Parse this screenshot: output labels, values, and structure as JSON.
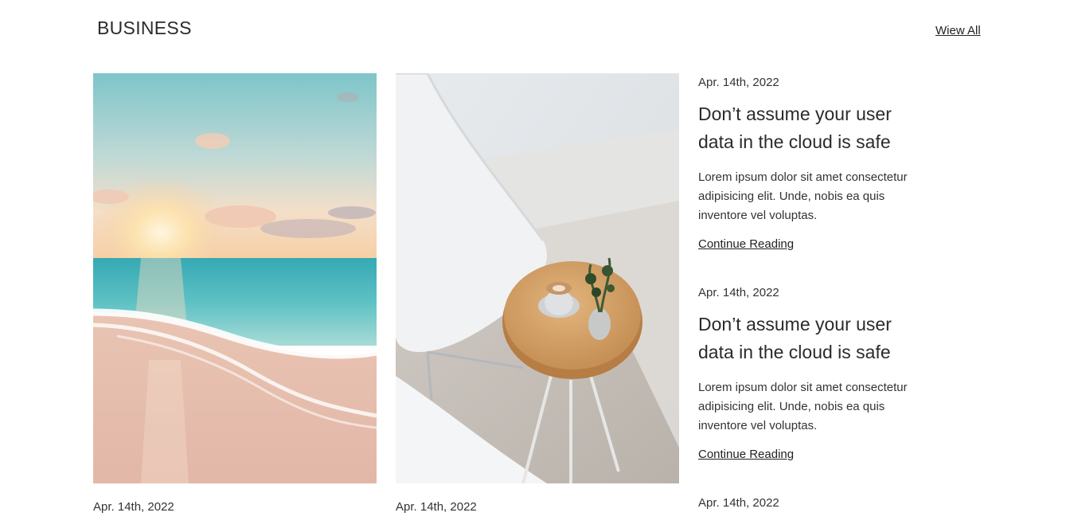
{
  "section": {
    "title": "BUSINESS",
    "view_all": "Wiew All"
  },
  "image_cards": [
    {
      "date": "Apr. 14th, 2022",
      "image": "beach-sunset-image"
    },
    {
      "date": "Apr. 14th, 2022",
      "image": "coffee-table-image"
    }
  ],
  "articles": [
    {
      "date": "Apr. 14th, 2022",
      "title": "Don’t assume your user data in the cloud is safe",
      "excerpt": "Lorem ipsum dolor sit amet consectetur adipisicing elit. Unde, nobis ea quis inventore vel voluptas.",
      "link": "Continue Reading"
    },
    {
      "date": "Apr. 14th, 2022",
      "title": "Don’t assume your user data in the cloud is safe",
      "excerpt": "Lorem ipsum dolor sit amet consectetur adipisicing elit. Unde, nobis ea quis inventore vel voluptas.",
      "link": "Continue Reading"
    },
    {
      "date": "Apr. 14th, 2022"
    }
  ],
  "colors": {
    "text": "#333333",
    "heading": "#2b2b2b",
    "background": "#ffffff"
  }
}
